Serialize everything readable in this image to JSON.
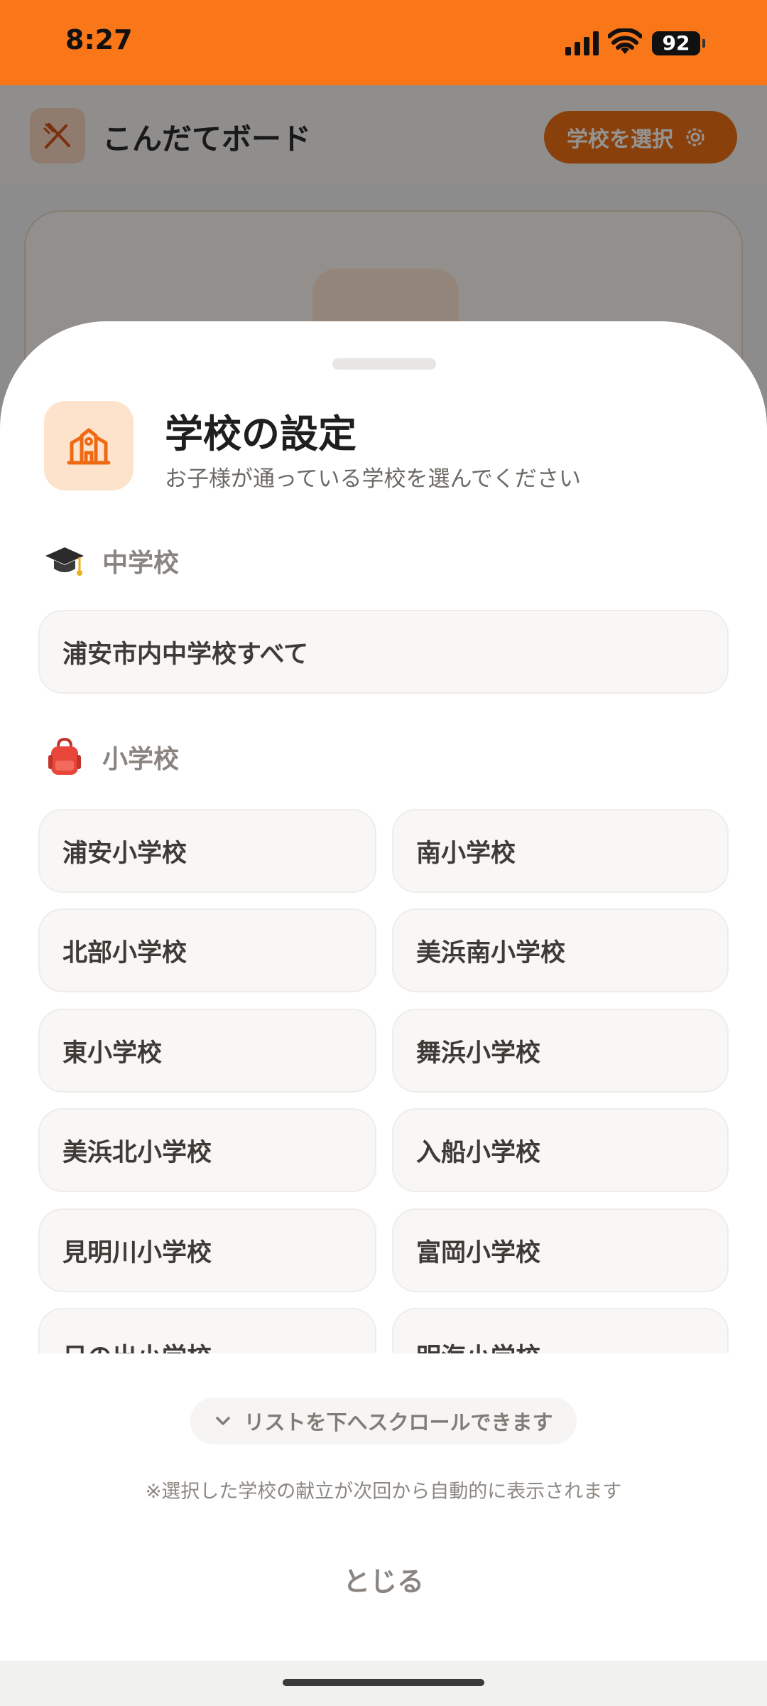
{
  "status_bar": {
    "time": "8:27",
    "battery": "92"
  },
  "background_app": {
    "title": "こんだてボード",
    "select_school_button": "学校を選択",
    "logo_icon": "fork-knife-crossed-icon",
    "settings_icon": "gear-icon"
  },
  "sheet": {
    "title": "学校の設定",
    "subtitle": "お子様が通っている学校を選んでください",
    "icon": "school-icon",
    "middle_school": {
      "label": "中学校",
      "icon": "graduation-cap-icon",
      "options": [
        "浦安市内中学校すべて"
      ]
    },
    "elementary_school": {
      "label": "小学校",
      "icon": "backpack-icon",
      "options": [
        "浦安小学校",
        "南小学校",
        "北部小学校",
        "美浜南小学校",
        "東小学校",
        "舞浜小学校",
        "美浜北小学校",
        "入船小学校",
        "見明川小学校",
        "富岡小学校",
        "日の出小学校",
        "明海小学校"
      ]
    },
    "scroll_hint": "リストを下へスクロールできます",
    "note": "※選択した学校の献立が次回から自動的に表示されます",
    "close_label": "とじる"
  },
  "colors": {
    "accent": "#fa7719",
    "chip_background": "#f8f7f5",
    "icon_tile": "#fde3cc"
  }
}
